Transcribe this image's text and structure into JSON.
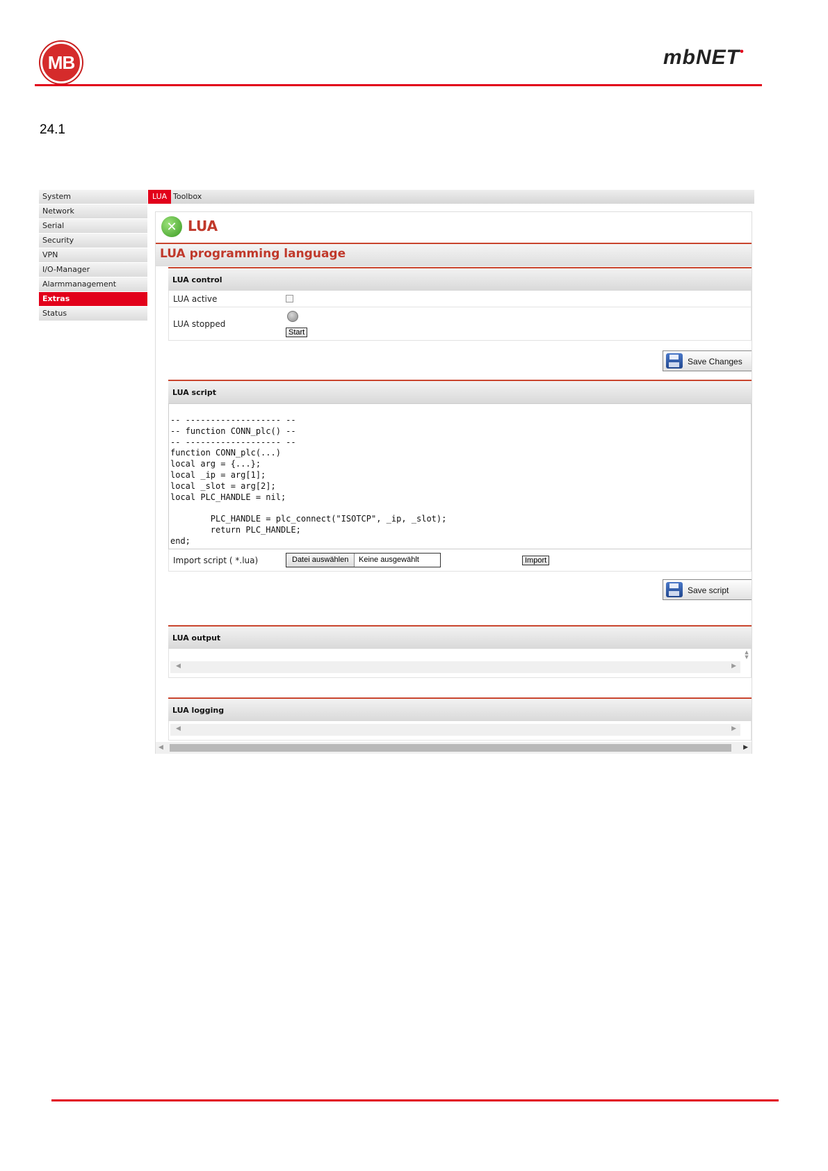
{
  "header": {
    "logo_text": "MB",
    "brand": "mbNET",
    "section_number": "24.1"
  },
  "sidebar": {
    "items": [
      {
        "label": "System"
      },
      {
        "label": "Network"
      },
      {
        "label": "Serial"
      },
      {
        "label": "Security"
      },
      {
        "label": "VPN"
      },
      {
        "label": "I/O-Manager"
      },
      {
        "label": "Alarmmanagement"
      },
      {
        "label": "Extras",
        "active": true
      },
      {
        "label": "Status"
      }
    ]
  },
  "tabs": [
    {
      "label": "LUA",
      "active": true
    },
    {
      "label": "Toolbox"
    }
  ],
  "page": {
    "title": "LUA",
    "subtitle": "LUA programming language"
  },
  "control": {
    "heading": "LUA control",
    "active_label": "LUA active",
    "active_checked": false,
    "stopped_label": "LUA stopped",
    "start_button": "Start",
    "save_button": "Save Changes"
  },
  "script": {
    "heading": "LUA script",
    "code": "-- ------------------- --\n-- function CONN_plc() --\n-- ------------------- --\nfunction CONN_plc(...)\nlocal arg = {...};\nlocal _ip = arg[1];\nlocal _slot = arg[2];\nlocal PLC_HANDLE = nil;\n\n        PLC_HANDLE = plc_connect(\"ISOTCP\", _ip, _slot);\n        return PLC_HANDLE;\nend;",
    "import_label": "Import script ( *.lua)",
    "file_choose": "Datei auswählen",
    "file_none": "Keine ausgewählt",
    "import_button": "Import",
    "save_button": "Save script"
  },
  "output": {
    "heading": "LUA output"
  },
  "logging": {
    "heading": "LUA logging"
  },
  "colors": {
    "accent": "#e2001a",
    "title": "#c0392b"
  }
}
